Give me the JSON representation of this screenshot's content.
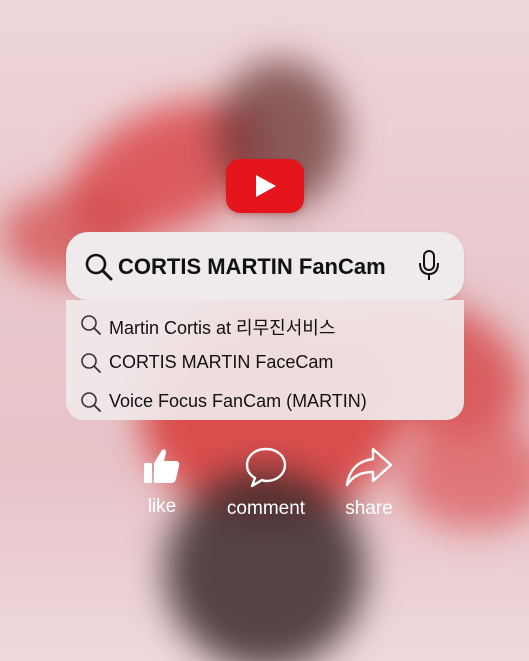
{
  "app": {
    "logo_icon": "youtube-play-icon",
    "brand_color": "#e4161c"
  },
  "search": {
    "query": "CORTIS MARTIN FanCam",
    "search_icon": "search-icon",
    "mic_icon": "mic-icon"
  },
  "suggestions": [
    {
      "label": "Martin Cortis at 리무진서비스"
    },
    {
      "label": "CORTIS MARTIN FaceCam"
    },
    {
      "label": "Voice Focus FanCam (MARTIN)"
    }
  ],
  "actions": {
    "like": {
      "label": "like",
      "icon": "thumbs-up-icon"
    },
    "comment": {
      "label": "comment",
      "icon": "speech-bubble-icon"
    },
    "share": {
      "label": "share",
      "icon": "share-arrow-icon"
    }
  }
}
